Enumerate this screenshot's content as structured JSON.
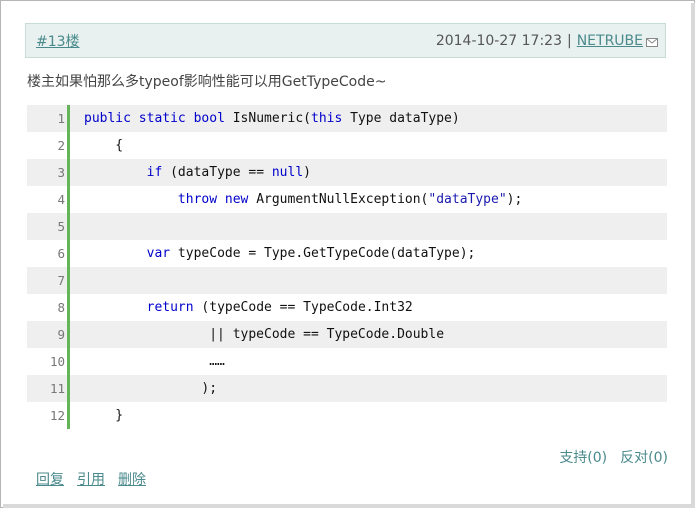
{
  "post": {
    "floor": "#13楼",
    "date": "2014-10-27 17:23",
    "separator": "|",
    "author": "NETRUBE",
    "comment": "楼主如果怕那么多typeof影响性能可以用GetTypeCode~"
  },
  "code": {
    "lines": [
      {
        "num": "1",
        "tokens": [
          {
            "t": "public",
            "k": "kw"
          },
          {
            "t": " "
          },
          {
            "t": "static",
            "k": "kw"
          },
          {
            "t": " "
          },
          {
            "t": "bool",
            "k": "kw"
          },
          {
            "t": " IsNumeric("
          },
          {
            "t": "this",
            "k": "kw"
          },
          {
            "t": " Type dataType)"
          }
        ]
      },
      {
        "num": "2",
        "tokens": [
          {
            "t": "    {"
          }
        ]
      },
      {
        "num": "3",
        "tokens": [
          {
            "t": "        "
          },
          {
            "t": "if",
            "k": "kw"
          },
          {
            "t": " (dataType == "
          },
          {
            "t": "null",
            "k": "kw"
          },
          {
            "t": ")"
          }
        ]
      },
      {
        "num": "4",
        "tokens": [
          {
            "t": "            "
          },
          {
            "t": "throw",
            "k": "kw"
          },
          {
            "t": " "
          },
          {
            "t": "new",
            "k": "kw"
          },
          {
            "t": " ArgumentNullException("
          },
          {
            "t": "\"dataType\"",
            "k": "str"
          },
          {
            "t": ");"
          }
        ]
      },
      {
        "num": "5",
        "tokens": []
      },
      {
        "num": "6",
        "tokens": [
          {
            "t": "        "
          },
          {
            "t": "var",
            "k": "kw"
          },
          {
            "t": " typeCode = Type.GetTypeCode(dataType);"
          }
        ]
      },
      {
        "num": "7",
        "tokens": []
      },
      {
        "num": "8",
        "tokens": [
          {
            "t": "        "
          },
          {
            "t": "return",
            "k": "kw"
          },
          {
            "t": " (typeCode == TypeCode.Int32"
          }
        ]
      },
      {
        "num": "9",
        "tokens": [
          {
            "t": "                || typeCode == TypeCode.Double"
          }
        ]
      },
      {
        "num": "10",
        "tokens": [
          {
            "t": "                ……"
          }
        ]
      },
      {
        "num": "11",
        "tokens": [
          {
            "t": "               );"
          }
        ]
      },
      {
        "num": "12",
        "tokens": [
          {
            "t": "    }"
          }
        ]
      }
    ]
  },
  "votes": {
    "support": "支持(0)",
    "against": "反对(0)"
  },
  "actions": {
    "reply": "回复",
    "quote": "引用",
    "delete": "删除"
  },
  "colors": {
    "accent": "#4a8a8c",
    "keyword": "#0000cc",
    "gutter": "#64b458",
    "header_bg": "#e8f1ef"
  },
  "icons": {
    "mail": "mail-icon"
  }
}
